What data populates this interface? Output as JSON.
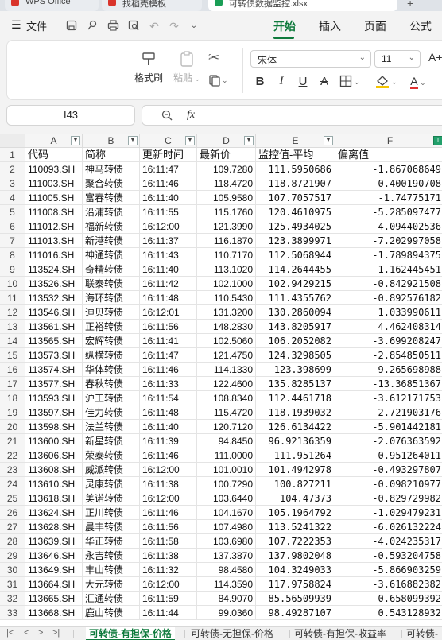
{
  "window": {
    "tabs": [
      {
        "label": "WPS Office",
        "color": "#d9342b"
      },
      {
        "label": "找稻壳模板",
        "color": "#d9342b"
      },
      {
        "label": "可转债数据监控.xlsx",
        "color": "#1a9e56"
      }
    ],
    "new_tab": "+"
  },
  "menu": {
    "file_label": "文件",
    "tabs": [
      "开始",
      "插入",
      "页面",
      "公式"
    ]
  },
  "ribbon": {
    "format_painter": "格式刷",
    "paste": "粘贴",
    "font_name": "宋体",
    "font_size": "11",
    "bold": "B",
    "italic": "I",
    "underline": "U",
    "strikethrough": "A",
    "font_color_letter": "A",
    "grow_font": "A+"
  },
  "formula_bar": {
    "cell_ref": "I43",
    "fx": "fx",
    "zoom_icon": "zoom-icon"
  },
  "sheet": {
    "columns": [
      "A",
      "B",
      "C",
      "D",
      "E",
      "F"
    ],
    "header_row": {
      "row": "1",
      "cells": [
        "代码",
        "简称",
        "更新时间",
        "最新价",
        "监控值-平均",
        "偏离值"
      ]
    },
    "rows": [
      {
        "row": "2",
        "cells": [
          "110093.SH",
          "神马转债",
          "16:11:47",
          "109.7280",
          "111.5950686",
          "-1.867068649"
        ]
      },
      {
        "row": "3",
        "cells": [
          "111003.SH",
          "聚合转债",
          "16:11:46",
          "118.4720",
          "118.8721907",
          "-0.400190708"
        ]
      },
      {
        "row": "4",
        "cells": [
          "111005.SH",
          "富春转债",
          "16:11:40",
          "105.9580",
          "107.7057517",
          "-1.74775171"
        ]
      },
      {
        "row": "5",
        "cells": [
          "111008.SH",
          "沿浦转债",
          "16:11:55",
          "115.1760",
          "120.4610975",
          "-5.285097477"
        ]
      },
      {
        "row": "6",
        "cells": [
          "111012.SH",
          "福新转债",
          "16:12:00",
          "121.3990",
          "125.4934025",
          "-4.094402536"
        ]
      },
      {
        "row": "7",
        "cells": [
          "111013.SH",
          "新港转债",
          "16:11:37",
          "116.1870",
          "123.3899971",
          "-7.202997058"
        ]
      },
      {
        "row": "8",
        "cells": [
          "111016.SH",
          "神通转债",
          "16:11:43",
          "110.7170",
          "112.5068944",
          "-1.789894375"
        ]
      },
      {
        "row": "9",
        "cells": [
          "113524.SH",
          "奇精转债",
          "16:11:40",
          "113.1020",
          "114.2644455",
          "-1.162445451"
        ]
      },
      {
        "row": "10",
        "cells": [
          "113526.SH",
          "联泰转债",
          "16:11:42",
          "102.1000",
          "102.9429215",
          "-0.842921508"
        ]
      },
      {
        "row": "11",
        "cells": [
          "113532.SH",
          "海环转债",
          "16:11:48",
          "110.5430",
          "111.4355762",
          "-0.892576182"
        ]
      },
      {
        "row": "12",
        "cells": [
          "113546.SH",
          "迪贝转债",
          "16:12:01",
          "131.3200",
          "130.2860094",
          "1.033990611"
        ]
      },
      {
        "row": "13",
        "cells": [
          "113561.SH",
          "正裕转债",
          "16:11:56",
          "148.2830",
          "143.8205917",
          "4.462408314"
        ]
      },
      {
        "row": "14",
        "cells": [
          "113565.SH",
          "宏辉转债",
          "16:11:41",
          "102.5060",
          "106.2052082",
          "-3.699208247"
        ]
      },
      {
        "row": "15",
        "cells": [
          "113573.SH",
          "纵横转债",
          "16:11:47",
          "121.4750",
          "124.3298505",
          "-2.854850511"
        ]
      },
      {
        "row": "16",
        "cells": [
          "113574.SH",
          "华体转债",
          "16:11:46",
          "114.1330",
          "123.398699",
          "-9.265698988"
        ]
      },
      {
        "row": "17",
        "cells": [
          "113577.SH",
          "春秋转债",
          "16:11:33",
          "122.4600",
          "135.8285137",
          "-13.36851367"
        ]
      },
      {
        "row": "18",
        "cells": [
          "113593.SH",
          "沪工转债",
          "16:11:54",
          "108.8340",
          "112.4461718",
          "-3.612171753"
        ]
      },
      {
        "row": "19",
        "cells": [
          "113597.SH",
          "佳力转债",
          "16:11:48",
          "115.4720",
          "118.1939032",
          "-2.721903176"
        ]
      },
      {
        "row": "20",
        "cells": [
          "113598.SH",
          "法兰转债",
          "16:11:40",
          "120.7120",
          "126.6134422",
          "-5.901442181"
        ]
      },
      {
        "row": "21",
        "cells": [
          "113600.SH",
          "新星转债",
          "16:11:39",
          "94.8450",
          "96.92136359",
          "-2.076363592"
        ]
      },
      {
        "row": "22",
        "cells": [
          "113606.SH",
          "荣泰转债",
          "16:11:46",
          "111.0000",
          "111.951264",
          "-0.951264011"
        ]
      },
      {
        "row": "23",
        "cells": [
          "113608.SH",
          "威派转债",
          "16:12:00",
          "101.0010",
          "101.4942978",
          "-0.493297807"
        ]
      },
      {
        "row": "24",
        "cells": [
          "113610.SH",
          "灵康转债",
          "16:11:38",
          "100.7290",
          "100.827211",
          "-0.098210977"
        ]
      },
      {
        "row": "25",
        "cells": [
          "113618.SH",
          "美诺转债",
          "16:12:00",
          "103.6440",
          "104.47373",
          "-0.829729982"
        ]
      },
      {
        "row": "26",
        "cells": [
          "113624.SH",
          "正川转债",
          "16:11:46",
          "104.1670",
          "105.1964792",
          "-1.029479231"
        ]
      },
      {
        "row": "27",
        "cells": [
          "113628.SH",
          "晨丰转债",
          "16:11:56",
          "107.4980",
          "113.5241322",
          "-6.026132224"
        ]
      },
      {
        "row": "28",
        "cells": [
          "113639.SH",
          "华正转债",
          "16:11:58",
          "103.6980",
          "107.7222353",
          "-4.024235317"
        ]
      },
      {
        "row": "29",
        "cells": [
          "113646.SH",
          "永吉转债",
          "16:11:38",
          "137.3870",
          "137.9802048",
          "-0.593204758"
        ]
      },
      {
        "row": "30",
        "cells": [
          "113649.SH",
          "丰山转债",
          "16:11:32",
          "98.4580",
          "104.3249033",
          "-5.866903259"
        ]
      },
      {
        "row": "31",
        "cells": [
          "113664.SH",
          "大元转债",
          "16:12:00",
          "114.3590",
          "117.9758824",
          "-3.616882382"
        ]
      },
      {
        "row": "32",
        "cells": [
          "113665.SH",
          "汇通转债",
          "16:11:59",
          "84.9070",
          "85.56509939",
          "-0.658099392"
        ]
      },
      {
        "row": "33",
        "cells": [
          "113668.SH",
          "鹿山转债",
          "16:11:44",
          "99.0360",
          "98.49287107",
          "0.543128932"
        ]
      }
    ]
  },
  "sheet_tabs": {
    "active": "可转债-有担保-价格",
    "others": [
      "可转债-无担保-价格",
      "可转债-有担保-收益率",
      "可转债-"
    ]
  },
  "colors": {
    "accent": "#0e7a3c",
    "filter_active": "#22a06b"
  }
}
